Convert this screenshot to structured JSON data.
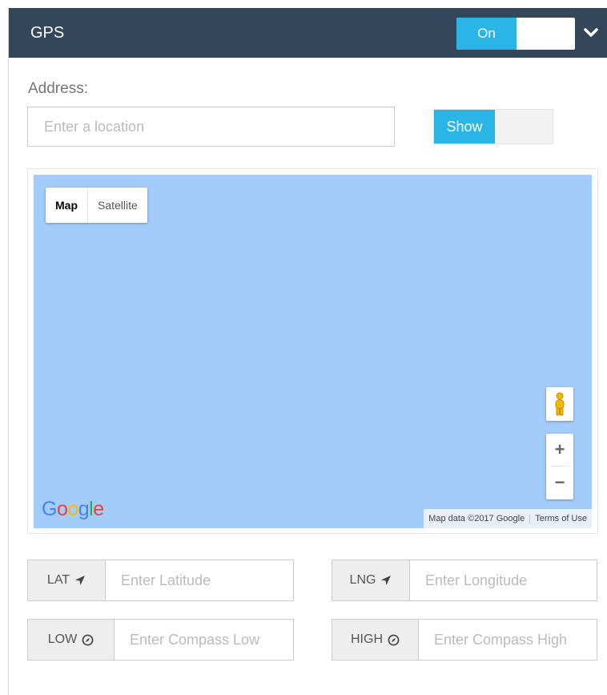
{
  "header": {
    "title": "GPS",
    "toggle_on_label": "On",
    "chevron_icon": "chevron-down-icon"
  },
  "address": {
    "label": "Address:",
    "placeholder": "Enter a location",
    "show_toggle_label": "Show"
  },
  "map": {
    "type_controls": [
      "Map",
      "Satellite"
    ],
    "active_type": "Map",
    "zoom_in": "+",
    "zoom_out": "−",
    "logo": [
      "G",
      "o",
      "o",
      "g",
      "l",
      "e"
    ],
    "logo_colors": [
      "#4285f4",
      "#ea4335",
      "#fbbc05",
      "#4285f4",
      "#34a853",
      "#ea4335"
    ],
    "attribution": "Map data ©2017 Google",
    "terms": "Terms of Use",
    "water_color": "#a3ccfb"
  },
  "coords": {
    "lat_label": "LAT",
    "lat_placeholder": "Enter Latitude",
    "lng_label": "LNG",
    "lng_placeholder": "Enter Longitude",
    "low_label": "LOW",
    "low_placeholder": "Enter Compass Low",
    "high_label": "HIGH",
    "high_placeholder": "Enter Compass High"
  },
  "colors": {
    "header_bg": "#34465a",
    "accent": "#2bb5e6"
  }
}
